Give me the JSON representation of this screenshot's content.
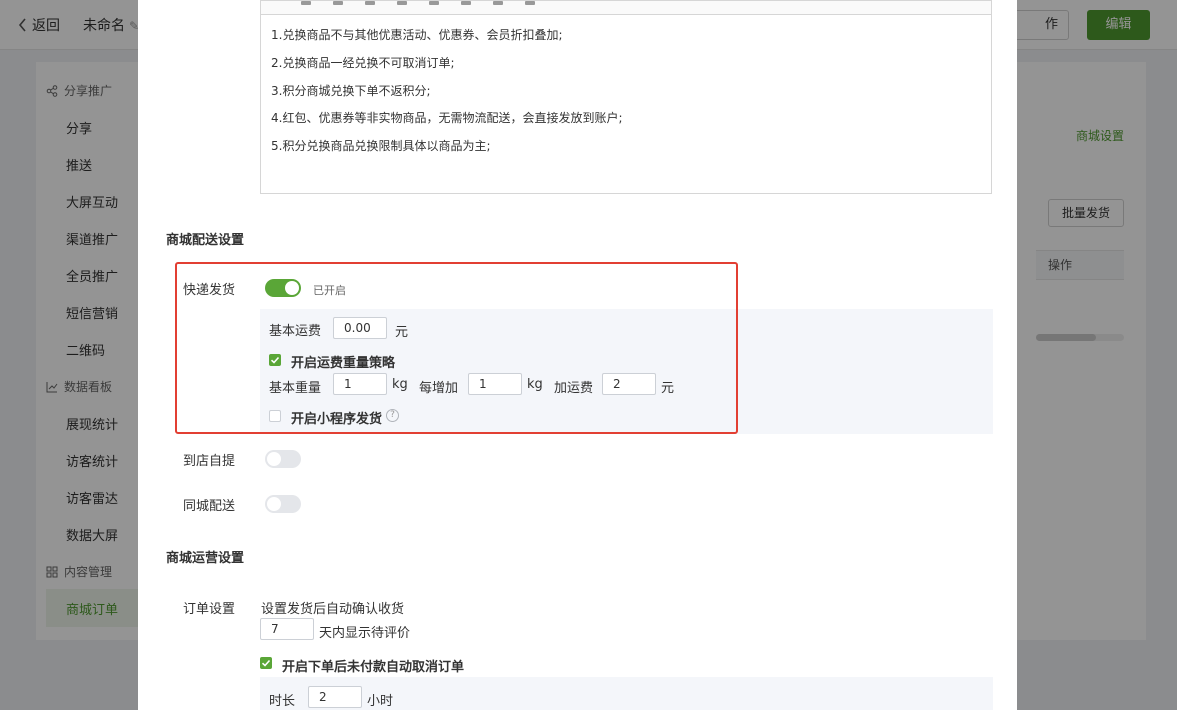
{
  "topbar": {
    "back_label": "返回",
    "doc_title": "未命名",
    "operation_label": "作",
    "edit_label": "编辑"
  },
  "sidebar": {
    "groups": [
      {
        "label": "分享推广",
        "icon": "share-icon"
      },
      {
        "label": "数据看板",
        "icon": "chart-icon"
      },
      {
        "label": "内容管理",
        "icon": "grid-icon"
      }
    ],
    "items": [
      {
        "label": "分享"
      },
      {
        "label": "推送"
      },
      {
        "label": "大屏互动"
      },
      {
        "label": "渠道推广"
      },
      {
        "label": "全员推广"
      },
      {
        "label": "短信营销"
      },
      {
        "label": "二维码"
      },
      {
        "label": "展现统计"
      },
      {
        "label": "访客统计"
      },
      {
        "label": "访客雷达"
      },
      {
        "label": "数据大屏"
      },
      {
        "label": "商城订单"
      }
    ]
  },
  "main": {
    "shop_settings_link": "商城设置",
    "batch_ship_label": "批量发货",
    "table_op_header": "操作"
  },
  "modal": {
    "editor_lines": [
      "1.兑换商品不与其他优惠活动、优惠券、会员折扣叠加;",
      "2.兑换商品一经兑换不可取消订单;",
      "3.积分商城兑换下单不返积分;",
      "4.红包、优惠券等非实物商品，无需物流配送，会直接发放到账户;",
      "5.积分兑换商品兑换限制具体以商品为主;"
    ],
    "delivery": {
      "title": "商城配送设置",
      "express": {
        "label": "快递发货",
        "status": "已开启",
        "enabled": true,
        "base_fee_label": "基本运费",
        "base_fee_value": "0.00",
        "base_fee_unit": "元",
        "weight_strategy_label": "开启运费重量策略",
        "weight_strategy_checked": true,
        "base_weight_label": "基本重量",
        "base_weight_value": "1",
        "weight_unit": "kg",
        "per_add_label": "每增加",
        "per_add_value": "1",
        "add_fee_label": "加运费",
        "add_fee_value": "2",
        "add_fee_unit": "元",
        "mini_program_label": "开启小程序发货",
        "mini_program_checked": false
      },
      "pickup": {
        "label": "到店自提",
        "enabled": false
      },
      "same_city": {
        "label": "同城配送",
        "enabled": false
      }
    },
    "operations": {
      "title": "商城运营设置",
      "order_label": "订单设置",
      "auto_confirm_label": "设置发货后自动确认收货",
      "days_value": "7",
      "days_suffix": "天内显示待评价",
      "auto_cancel_label": "开启下单后未付款自动取消订单",
      "auto_cancel_checked": true,
      "duration_label": "时长",
      "duration_value": "2",
      "duration_unit": "小时"
    }
  },
  "colors": {
    "brand_green": "#4f9a2f",
    "toggle_on": "#5aa637",
    "highlight_red": "#e23f33"
  }
}
